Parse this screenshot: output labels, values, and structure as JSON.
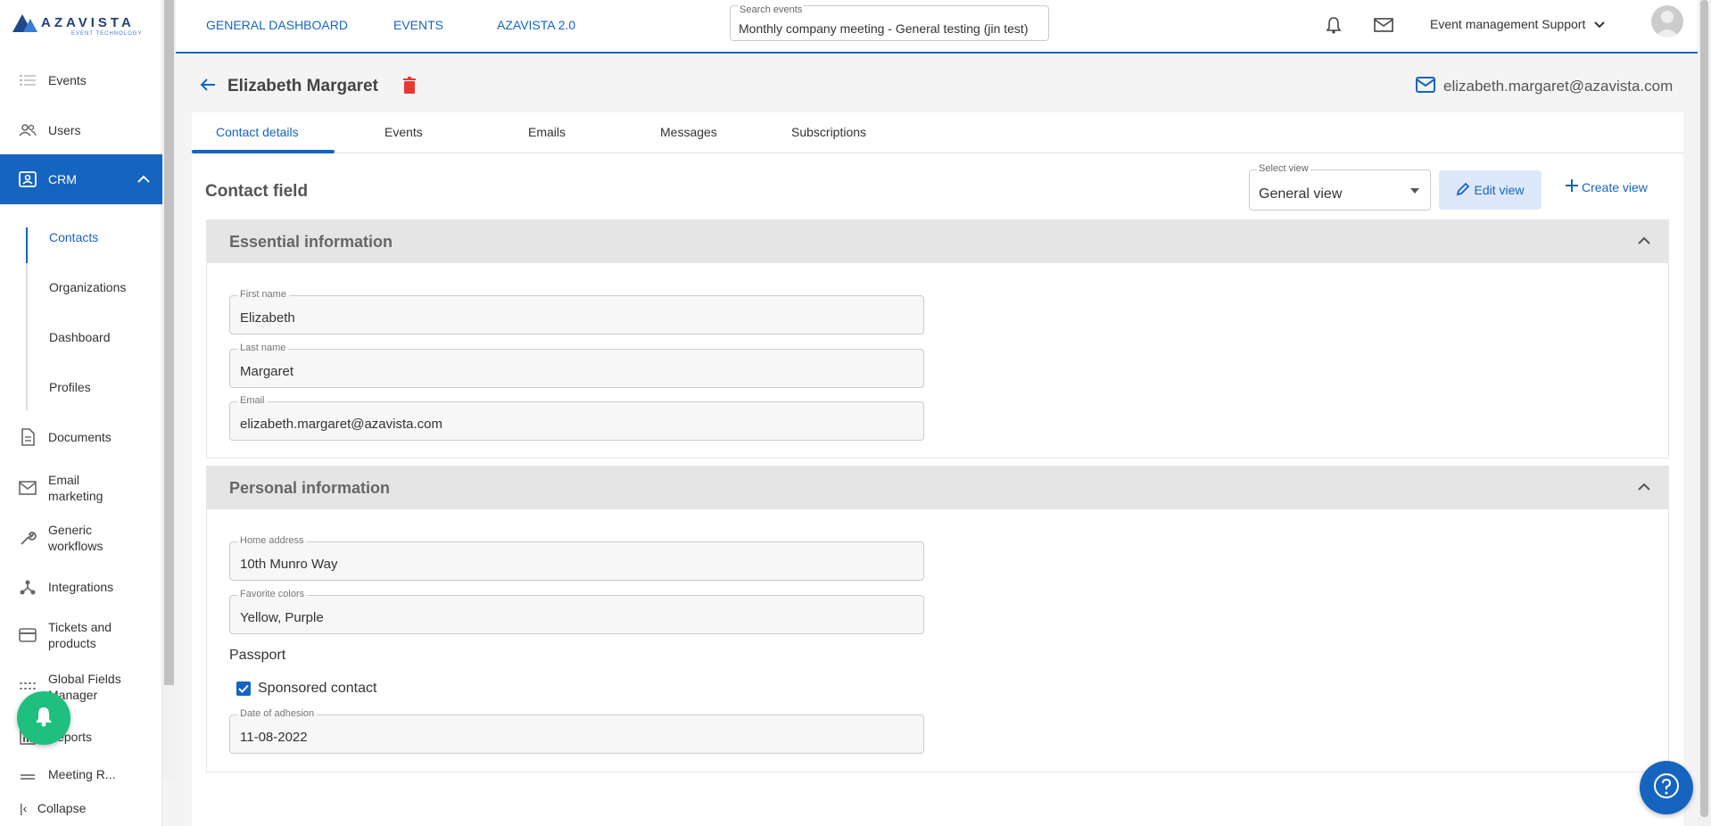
{
  "brand": {
    "name": "AZAVISTA",
    "tagline": "EVENT TECHNOLOGY"
  },
  "sidebar": {
    "items": [
      {
        "label": "Events",
        "icon": "list-icon"
      },
      {
        "label": "Users",
        "icon": "users-icon"
      },
      {
        "label": "CRM",
        "icon": "contact-card-icon"
      },
      {
        "label": "Documents",
        "icon": "document-icon"
      },
      {
        "label": "Email marketing",
        "icon": "mail-icon"
      },
      {
        "label": "Generic workflows",
        "icon": "wrench-icon"
      },
      {
        "label": "Integrations",
        "icon": "integration-icon"
      },
      {
        "label": "Tickets and products",
        "icon": "credit-card-icon"
      },
      {
        "label": "Global Fields Manager",
        "icon": "fields-icon"
      },
      {
        "label": "Reports",
        "icon": "report-icon"
      },
      {
        "label": "Meeting R...",
        "icon": "meeting-icon"
      }
    ],
    "crm_sub": [
      "Contacts",
      "Organizations",
      "Dashboard",
      "Profiles"
    ],
    "collapse_label": "Collapse"
  },
  "topbar": {
    "links": [
      "GENERAL DASHBOARD",
      "EVENTS",
      "AZAVISTA 2.0"
    ],
    "search": {
      "label": "Search events",
      "value": "Monthly company meeting - General testing (jin test)"
    },
    "user": "Event management Support"
  },
  "contact": {
    "name": "Elizabeth Margaret",
    "email": "elizabeth.margaret@azavista.com"
  },
  "tabs": [
    "Contact details",
    "Events",
    "Emails",
    "Messages",
    "Subscriptions"
  ],
  "contact_field": {
    "title": "Contact field",
    "select_view": {
      "label": "Select view",
      "value": "General view"
    },
    "edit_label": "Edit view",
    "create_label": "Create view"
  },
  "essential": {
    "title": "Essential information",
    "fields": [
      {
        "label": "First name",
        "value": "Elizabeth"
      },
      {
        "label": "Last name",
        "value": "Margaret"
      },
      {
        "label": "Email",
        "value": "elizabeth.margaret@azavista.com"
      }
    ]
  },
  "personal": {
    "title": "Personal information",
    "fields": [
      {
        "label": "Home address",
        "value": "10th Munro Way"
      },
      {
        "label": "Favorite colors",
        "value": "Yellow, Purple"
      }
    ],
    "passport_label": "Passport",
    "sponsored_label": "Sponsored contact",
    "sponsored_checked": true,
    "adhesion": {
      "label": "Date of adhesion",
      "value": "11-08-2022"
    }
  },
  "colors": {
    "primary": "#1565c0",
    "notify": "#1fbf7f",
    "danger": "#e53935"
  }
}
